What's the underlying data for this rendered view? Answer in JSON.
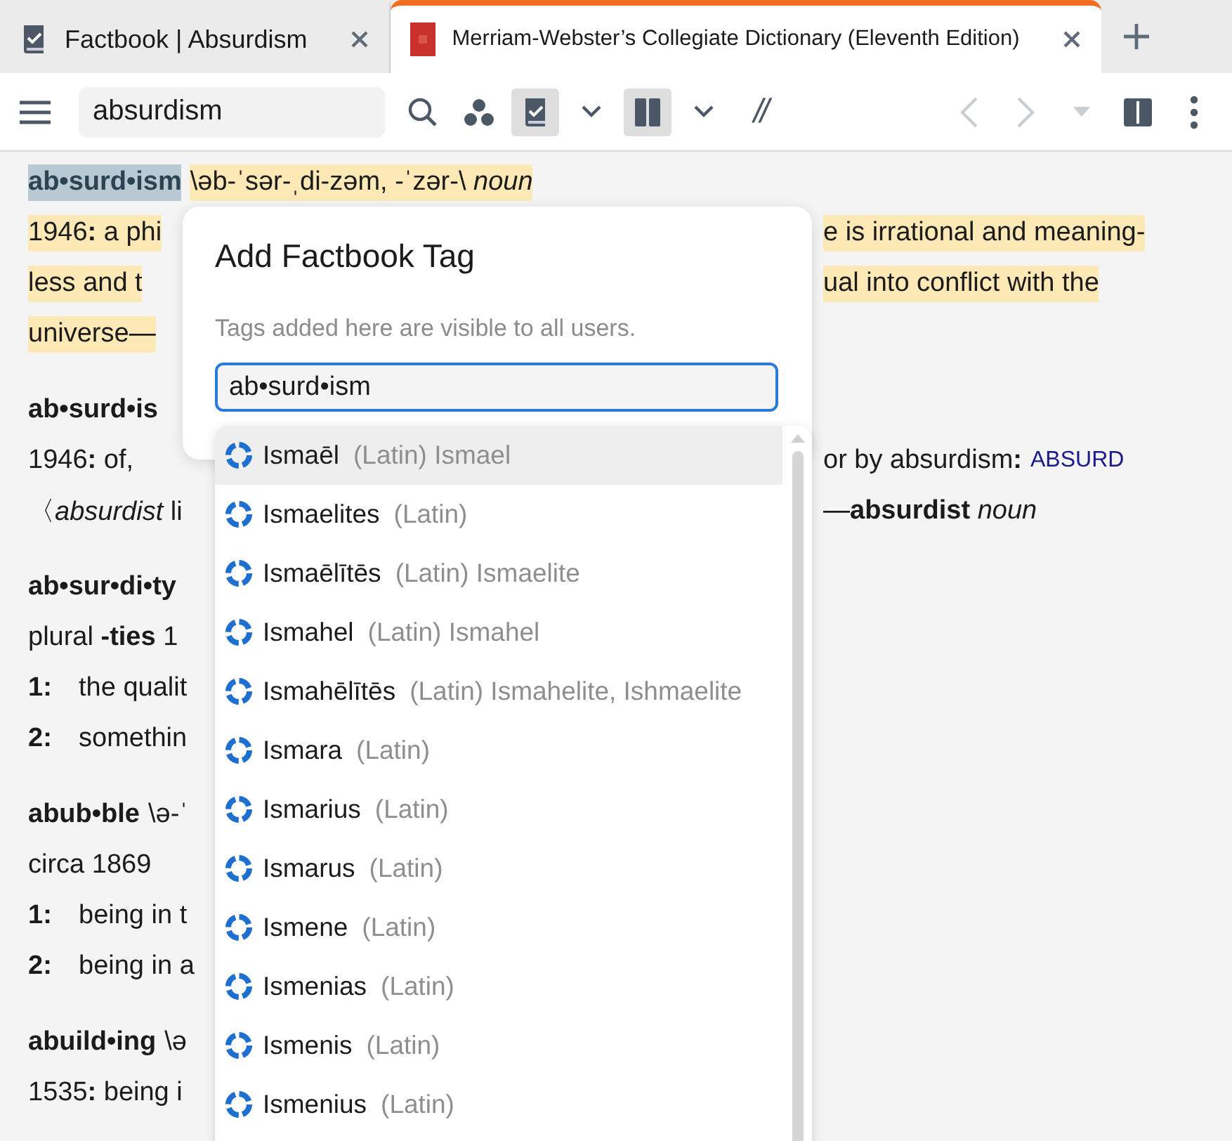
{
  "tabs": [
    {
      "label": "Factbook | Absurdism",
      "kind": "factbook",
      "selected": false
    },
    {
      "label": "Merriam-Webster’s Collegiate Dictionary (Eleventh Edition)",
      "kind": "book",
      "selected": true
    }
  ],
  "toolbar": {
    "search": {
      "value": "absurdism"
    },
    "tools": [
      {
        "kind": "search",
        "on": false
      },
      {
        "kind": "dots",
        "on": false
      },
      {
        "kind": "factbook",
        "on": true
      },
      {
        "kind": "chevron",
        "on": false
      },
      {
        "kind": "columns",
        "on": true
      },
      {
        "kind": "chevron",
        "on": false
      },
      {
        "kind": "text",
        "label": "//",
        "on": false
      }
    ],
    "nav": [
      {
        "kind": "back",
        "disabled": true
      },
      {
        "kind": "forward",
        "disabled": true
      },
      {
        "kind": "caret",
        "disabled": true
      },
      {
        "kind": "panel",
        "disabled": false
      },
      {
        "kind": "more",
        "disabled": false
      }
    ]
  },
  "entries": [
    {
      "lines": [
        {
          "left": [
            {
              "kind": "headword",
              "text": "ab•surd•ism",
              "selected": true
            },
            {
              "kind": "text",
              "text": "\\əb-ˈsər-ˌdi-zəm, -ˈzər-\\ *noun*",
              "highlighted": true
            }
          ]
        },
        {
          "left": [
            {
              "kind": "text",
              "text": "1946**:** a phi",
              "highlighted": true
            }
          ],
          "right": [
            {
              "kind": "text",
              "text": "e is irrational and meaning-",
              "highlighted": true
            }
          ]
        },
        {
          "left": [
            {
              "kind": "text",
              "text": "less and t",
              "highlighted": true
            }
          ],
          "right": [
            {
              "kind": "text",
              "text": "ual into conflict with the",
              "highlighted": true
            }
          ]
        },
        {
          "left": [
            {
              "kind": "text",
              "text": "universe—",
              "highlighted": true
            }
          ]
        }
      ]
    },
    {
      "lines": [
        {
          "left": [
            {
              "kind": "headword",
              "text": "ab•surd•is",
              "selected": false
            }
          ]
        },
        {
          "left": [
            {
              "kind": "text",
              "text": "1946**:** of,",
              "highlighted": false
            }
          ],
          "right": [
            {
              "kind": "text",
              "text": "or by absurdism**:**",
              "highlighted": false
            },
            {
              "kind": "xref",
              "text": "ABSURD",
              "highlighted": false
            }
          ]
        },
        {
          "left": [
            {
              "kind": "text",
              "text": "〈*absurdist* li",
              "highlighted": false
            }
          ],
          "right": [
            {
              "kind": "text",
              "text": "—**absurdist** *noun*",
              "highlighted": false
            }
          ]
        }
      ]
    },
    {
      "lines": [
        {
          "left": [
            {
              "kind": "headword",
              "text": "ab•sur•di•ty",
              "selected": false
            }
          ]
        },
        {
          "left": [
            {
              "kind": "text",
              "text": "plural **-ties** 1",
              "highlighted": false
            }
          ]
        },
        {
          "left": [
            {
              "kind": "number",
              "text": "1:",
              "highlighted": false
            },
            {
              "kind": "text",
              "text": "the qualit",
              "highlighted": false
            }
          ]
        },
        {
          "left": [
            {
              "kind": "number",
              "text": "2:",
              "highlighted": false
            },
            {
              "kind": "text",
              "text": "somethin",
              "highlighted": false
            }
          ]
        }
      ]
    },
    {
      "lines": [
        {
          "left": [
            {
              "kind": "headword",
              "text": "abub•ble",
              "selected": false
            },
            {
              "kind": "text",
              "text": "\\ə-ˈ",
              "highlighted": false
            }
          ]
        },
        {
          "left": [
            {
              "kind": "text",
              "text": "circa 1869",
              "highlighted": false
            }
          ]
        },
        {
          "left": [
            {
              "kind": "number",
              "text": "1:",
              "highlighted": false
            },
            {
              "kind": "text",
              "text": "being in t",
              "highlighted": false
            }
          ]
        },
        {
          "left": [
            {
              "kind": "number",
              "text": "2:",
              "highlighted": false
            },
            {
              "kind": "text",
              "text": "being in a",
              "highlighted": false
            }
          ]
        }
      ]
    },
    {
      "lines": [
        {
          "left": [
            {
              "kind": "headword",
              "text": "abuild•ing",
              "selected": false
            },
            {
              "kind": "text",
              "text": "\\ə",
              "highlighted": false
            }
          ]
        },
        {
          "left": [
            {
              "kind": "text",
              "text": "1535**:** being i",
              "highlighted": false
            }
          ]
        }
      ]
    }
  ],
  "popup": {
    "title": "Add Factbook Tag",
    "hint": "Tags added here are visible to all users.",
    "input": {
      "value": "ab•surd•ism"
    },
    "suggestions": [
      {
        "name": "Ismaēl",
        "detail": "(Latin) Ismael",
        "selected": true
      },
      {
        "name": "Ismaelites",
        "detail": "(Latin)",
        "selected": false
      },
      {
        "name": "Ismaēlītēs",
        "detail": "(Latin) Ismaelite",
        "selected": false
      },
      {
        "name": "Ismahel",
        "detail": "(Latin) Ismahel",
        "selected": false
      },
      {
        "name": "Ismahēlītēs",
        "detail": "(Latin) Ismahelite, Ishmaelite",
        "selected": false
      },
      {
        "name": "Ismara",
        "detail": "(Latin)",
        "selected": false
      },
      {
        "name": "Ismarius",
        "detail": "(Latin)",
        "selected": false
      },
      {
        "name": "Ismarus",
        "detail": "(Latin)",
        "selected": false
      },
      {
        "name": "Ismene",
        "detail": "(Latin)",
        "selected": false
      },
      {
        "name": "Ismenias",
        "detail": "(Latin)",
        "selected": false
      },
      {
        "name": "Ismenis",
        "detail": "(Latin)",
        "selected": false
      },
      {
        "name": "Ismenius",
        "detail": "(Latin)",
        "selected": false
      }
    ]
  }
}
